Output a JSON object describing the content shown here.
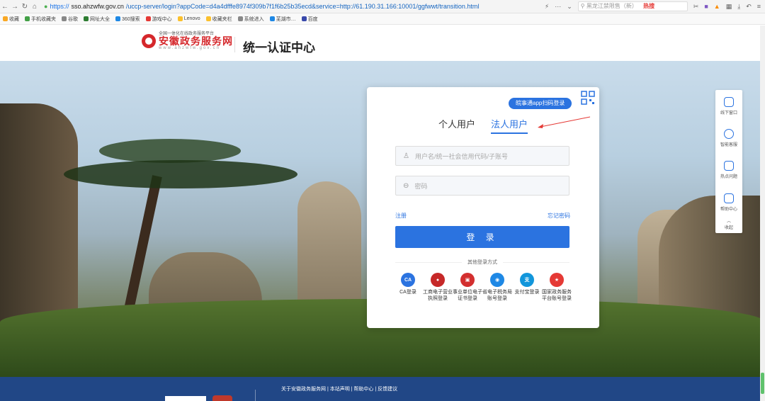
{
  "browser": {
    "url_protocol": "https://",
    "url_host": "sso.ahzwfw.gov.cn",
    "url_path": "/uccp-server/login?appCode=d4a4dfffe8974f309b7f1f6b25b35ecd&service=http://61.190.31.166:10001/ggfwwt/transition.html",
    "search_placeholder": "黑龙江禁限售（新）",
    "hot_label": "热搜",
    "bookmarks": [
      "收藏",
      "手机收藏夹",
      "谷歌",
      "网址大全",
      "360搜索",
      "游戏中心",
      "Lenovo",
      "收藏夹栏",
      "系统进入",
      "芜湖市…",
      "百度"
    ]
  },
  "header": {
    "logo_small": "全国一体化在线政务服务平台",
    "logo_main": "安徽政务服务网",
    "logo_sub": "www.ahzwfw.gov.cn",
    "title": "统一认证中心"
  },
  "login": {
    "qr_tip": "皖事通app扫码登录",
    "tabs": [
      "个人用户",
      "法人用户"
    ],
    "active_tab": "法人用户",
    "username_placeholder": "用户名/统一社会信用代码/子账号",
    "password_placeholder": "密码",
    "register": "注册",
    "forgot": "忘记密码",
    "submit": "登 录",
    "other_label": "其他登录方式",
    "methods": [
      {
        "label": "CA登录",
        "icon": "CA",
        "color": "#2b73e0"
      },
      {
        "label": "工商电子营业执照登录",
        "icon": "seal-icon",
        "color": "#c62828"
      },
      {
        "label": "事业单位电子证书登录",
        "icon": "building-icon",
        "color": "#d32f2f"
      },
      {
        "label": "省电子税务局账号登录",
        "icon": "tax-icon",
        "color": "#1e88e5"
      },
      {
        "label": "支付宝登录",
        "icon": "支",
        "color": "#1296db"
      },
      {
        "label": "国家政务服务平台账号登录",
        "icon": "emblem-icon",
        "color": "#e53935"
      }
    ]
  },
  "side_tools": [
    "线下窗口",
    "智能客服",
    "热点问题",
    "帮助中心",
    "收起"
  ],
  "footer": {
    "links": "关于安徽政务服务网 | 本站声明 | 帮助中心 | 反馈建议"
  },
  "colors": {
    "accent": "#2b73e0",
    "brand_red": "#d5272b",
    "footer_bg": "#214786"
  }
}
